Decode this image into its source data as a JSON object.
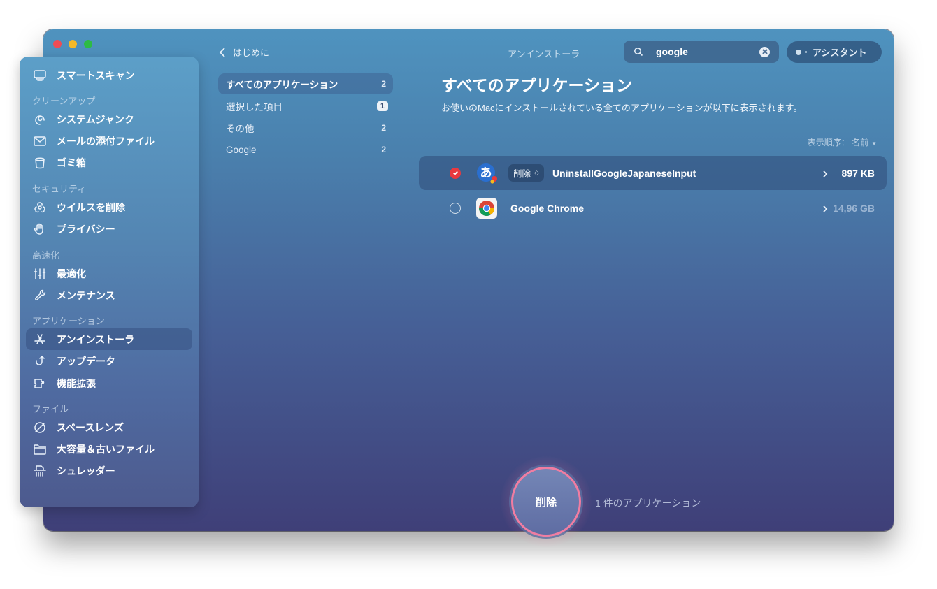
{
  "window": {
    "title": "アンインストーラ",
    "traffic_lights": [
      "close",
      "minimize",
      "maximize"
    ]
  },
  "sidebar": {
    "items": [
      {
        "type": "item",
        "label": "スマートスキャン",
        "icon": "monitor-icon"
      },
      {
        "type": "header",
        "label": "クリーンアップ"
      },
      {
        "type": "item",
        "label": "システムジャンク",
        "icon": "swirl-icon"
      },
      {
        "type": "item",
        "label": "メールの添付ファイル",
        "icon": "envelope-icon"
      },
      {
        "type": "item",
        "label": "ゴミ箱",
        "icon": "trash-bin-icon"
      },
      {
        "type": "header",
        "label": "セキュリティ"
      },
      {
        "type": "item",
        "label": "ウイルスを削除",
        "icon": "biohazard-icon"
      },
      {
        "type": "item",
        "label": "プライバシー",
        "icon": "hand-icon"
      },
      {
        "type": "header",
        "label": "高速化"
      },
      {
        "type": "item",
        "label": "最適化",
        "icon": "sliders-icon"
      },
      {
        "type": "item",
        "label": "メンテナンス",
        "icon": "wrench-icon"
      },
      {
        "type": "header",
        "label": "アプリケーション"
      },
      {
        "type": "item",
        "label": "アンインストーラ",
        "icon": "app-store-icon",
        "active": true
      },
      {
        "type": "item",
        "label": "アップデータ",
        "icon": "update-arrow-icon"
      },
      {
        "type": "item",
        "label": "機能拡張",
        "icon": "puzzle-icon"
      },
      {
        "type": "header",
        "label": "ファイル"
      },
      {
        "type": "item",
        "label": "スペースレンズ",
        "icon": "planet-icon"
      },
      {
        "type": "item",
        "label": "大容量＆古いファイル",
        "icon": "folder-icon"
      },
      {
        "type": "item",
        "label": "シュレッダー",
        "icon": "shredder-icon"
      }
    ]
  },
  "nav": {
    "back_label": "はじめに"
  },
  "categories": [
    {
      "label": "すべてのアプリケーション",
      "count": "2",
      "active": true
    },
    {
      "label": "選択した項目",
      "count": "1",
      "badge": true
    },
    {
      "label": "その他",
      "count": "2"
    },
    {
      "label": "Google",
      "count": "2"
    }
  ],
  "search": {
    "value": "google",
    "placeholder": "検索"
  },
  "assistant": {
    "label": "アシスタント"
  },
  "main": {
    "title": "すべてのアプリケーション",
    "subtitle": "お使いのMacにインストールされている全てのアプリケーションが以下に表示されます。",
    "sort_label": "表示順序：",
    "sort_value": "名前"
  },
  "apps": [
    {
      "name": "UninstallGoogleJapaneseInput",
      "size": "897 KB",
      "checked": true,
      "action": "削除",
      "icon": "google-japanese-input-icon"
    },
    {
      "name": "Google Chrome",
      "size": "14,96 GB",
      "checked": false,
      "icon": "chrome-icon"
    }
  ],
  "footer": {
    "button_label": "削除",
    "summary": "1 件のアプリケーション"
  },
  "colors": {
    "accent_pink": "#f07da2",
    "check_red": "#e9393f",
    "close": "#ee4c55",
    "minimize": "#f5b928",
    "maximize": "#2dbb45"
  }
}
